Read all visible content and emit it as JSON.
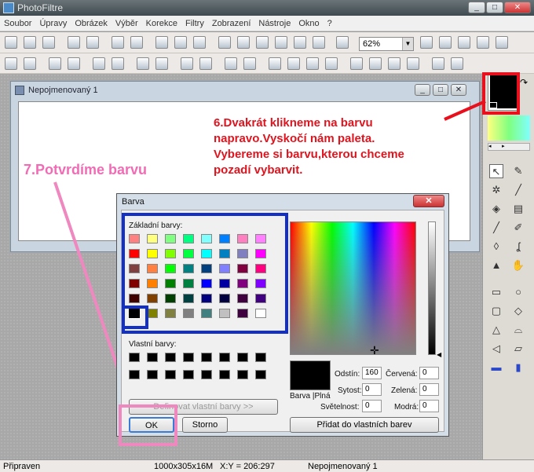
{
  "app": {
    "title": "PhotoFiltre",
    "window_buttons": [
      "_",
      "□",
      "✕"
    ]
  },
  "menu": [
    "Soubor",
    "Úpravy",
    "Obrázek",
    "Výběr",
    "Korekce",
    "Filtry",
    "Zobrazení",
    "Nástroje",
    "Okno",
    "?"
  ],
  "toolbar": {
    "zoom": "62%"
  },
  "document": {
    "title": "Nepojmenovaný 1",
    "buttons": [
      "_",
      "□",
      "✕"
    ]
  },
  "annotations": {
    "step6": "6.Dvakrát klikneme na barvu\nnapravo.Vyskočí nám paleta.\nVybereme si barvu,kterou chceme\npozadí vybarvit.",
    "step7": "7.Potvrdíme barvu"
  },
  "dialog": {
    "title": "Barva",
    "basic_label": "Základní barvy:",
    "custom_label": "Vlastní barvy:",
    "define_custom": "Definovat vlastní barvy >>",
    "ok": "OK",
    "cancel": "Storno",
    "solid_label": "Barva |Plná",
    "hue_label": "Odstín:",
    "hue": "160",
    "sat_label": "Sytost:",
    "sat": "0",
    "lum_label": "Světelnost:",
    "lum": "0",
    "red_label": "Červená:",
    "red": "0",
    "green_label": "Zelená:",
    "green": "0",
    "blue_label": "Modrá:",
    "blue": "0",
    "add_custom": "Přidat do vlastních barev",
    "basic_colors": [
      "#ff8080",
      "#ffff80",
      "#80ff80",
      "#00ff80",
      "#80ffff",
      "#0080ff",
      "#ff80c0",
      "#ff80ff",
      "#ff0000",
      "#ffff00",
      "#80ff00",
      "#00ff40",
      "#00ffff",
      "#0080c0",
      "#8080c0",
      "#ff00ff",
      "#804040",
      "#ff8040",
      "#00ff00",
      "#008080",
      "#004080",
      "#8080ff",
      "#800040",
      "#ff0080",
      "#800000",
      "#ff8000",
      "#008000",
      "#008040",
      "#0000ff",
      "#0000a0",
      "#800080",
      "#8000ff",
      "#400000",
      "#804000",
      "#004000",
      "#004040",
      "#000080",
      "#000040",
      "#400040",
      "#400080",
      "#000000",
      "#808000",
      "#808040",
      "#808080",
      "#408080",
      "#c0c0c0",
      "#400040",
      "#ffffff"
    ]
  },
  "palette": {
    "foreground": "#000000",
    "background": "#ffffff"
  },
  "status": {
    "ready": "Připraven",
    "size": "1000x305x16M",
    "coords": "X:Y = 206:297",
    "doc": "Nepojmenovaný 1"
  }
}
